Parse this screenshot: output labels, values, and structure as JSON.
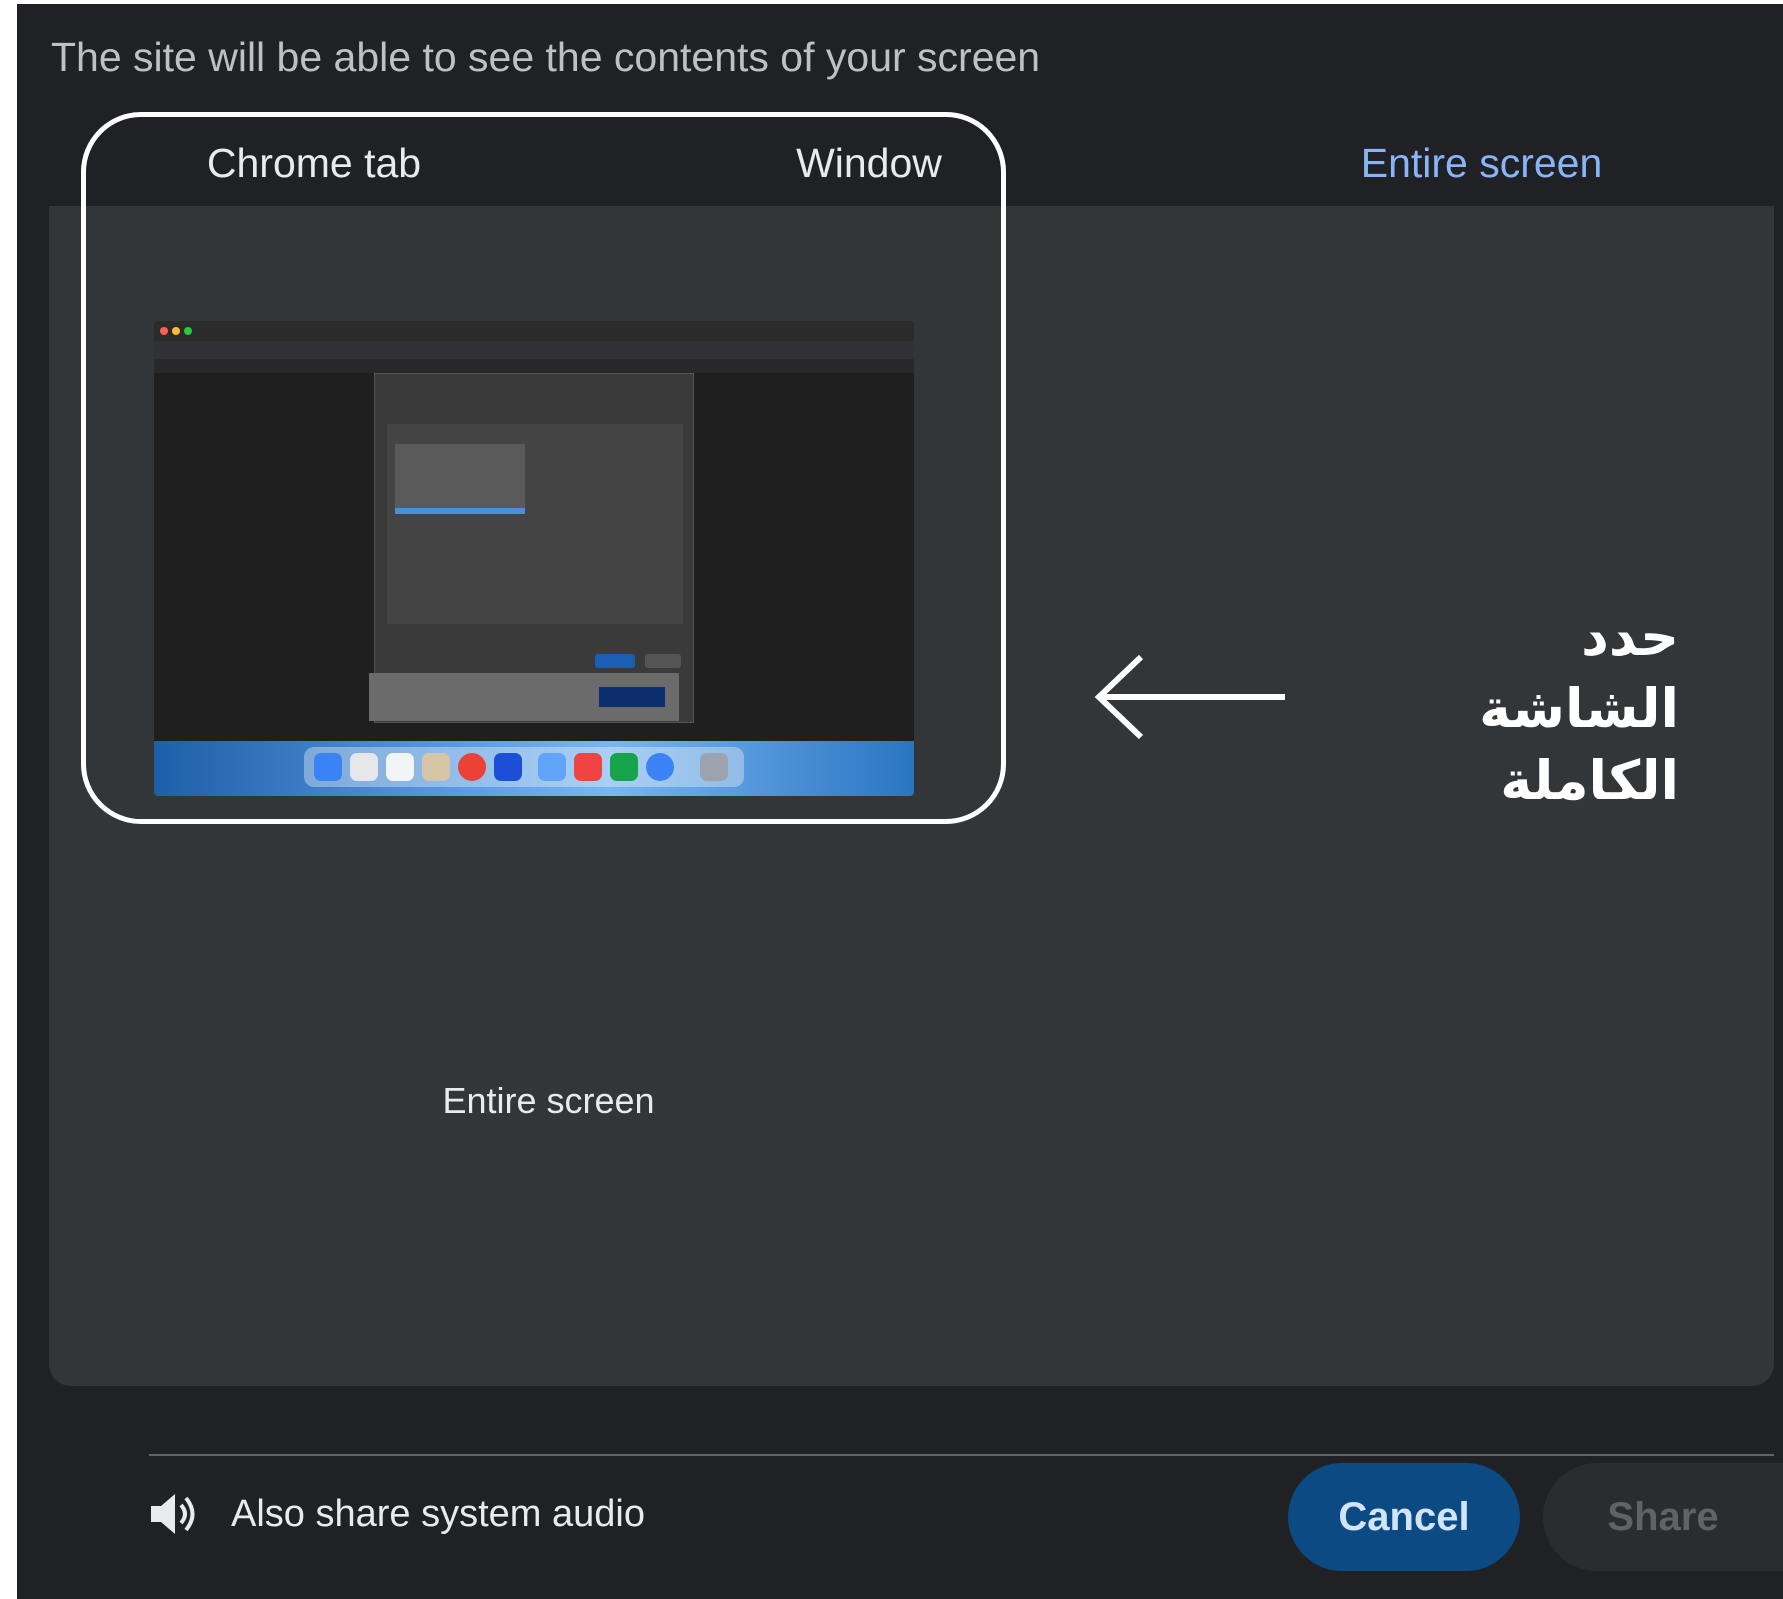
{
  "dialog": {
    "subtitle": "The site will be able to see the contents of your screen"
  },
  "tabs": [
    {
      "label": "Chrome tab",
      "active": false
    },
    {
      "label": "Window",
      "active": false
    },
    {
      "label": "Entire screen",
      "active": true
    }
  ],
  "preview": {
    "label": "Entire screen"
  },
  "annotation": {
    "lines": [
      "حدد",
      "الشاشة",
      "الكاملة"
    ],
    "arrow": "left-arrow"
  },
  "audio": {
    "label": "Also share system audio",
    "icon": "speaker-icon",
    "enabled": false
  },
  "buttons": {
    "cancel": "Cancel",
    "share": "Share"
  },
  "colors": {
    "dialog_bg": "#202124",
    "panel_bg": "#323639",
    "accent": "#8ab4f8",
    "cancel_bg": "#0b4a83"
  }
}
